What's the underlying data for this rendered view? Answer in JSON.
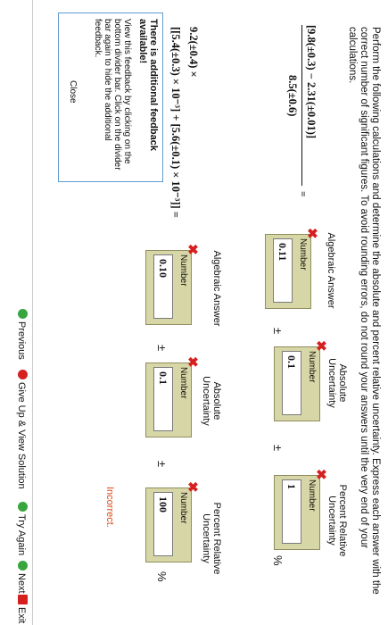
{
  "instructions": "Perform the following calculations and determine the absolute and percent relative uncertainty. Express each answer with the correct number of significant figures. To avoid rounding errors, do not round your answers until the very end of your calculations.",
  "problem1": {
    "numerator": "[9.8(±0.3) − 2.31(±0.01)]",
    "denominator": "8.5(±0.6)",
    "equals": "=",
    "headers": {
      "algebraic": "Algebraic Answer",
      "absolute": "Absolute Uncertainty",
      "percent": "Percent Relative Uncertainty"
    },
    "answers": {
      "label": "Number",
      "algebraic": "0.11",
      "absolute": "0.1",
      "percent": "1"
    },
    "pm": "±",
    "pct": "%"
  },
  "problem2": {
    "line1": "9.2(±0.4) ×",
    "line2": "[[5.4(±0.3) × 10⁻³] + [5.6(±0.1) × 10⁻³]] =",
    "headers": {
      "algebraic": "Algebraic Answer",
      "absolute": "Absolute Uncertainty",
      "percent": "Percent Relative Uncertainty"
    },
    "answers": {
      "label": "Number",
      "algebraic": "0.10",
      "absolute": "0.1",
      "percent": "100"
    },
    "pm": "±",
    "pct": "%"
  },
  "feedback": {
    "title": "There is additional feedback available!",
    "body": "View this feedback by clicking on the bottom divider bar. Click on the divider bar again to hide the additional feedback.",
    "close": "Close"
  },
  "status": {
    "incorrect": "Incorrect."
  },
  "nav": {
    "previous": "Previous",
    "give_up": "Give Up & View Solution",
    "try_again": "Try Again",
    "next": "Next",
    "exit": "Exit"
  },
  "colors": {
    "box": "#d6d6a6",
    "error": "#d62020",
    "incorrect": "#d64a18",
    "feedback_border": "#5f9bd0"
  }
}
